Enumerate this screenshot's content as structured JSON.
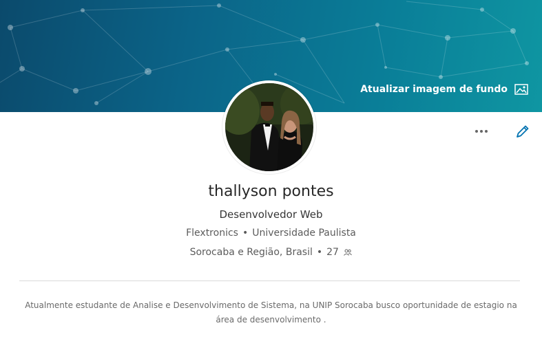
{
  "banner": {
    "update_background_label": "Atualizar imagem de fundo",
    "update_background_icon": "image-icon"
  },
  "profile": {
    "name": "thallyson pontes",
    "headline": "Desenvolvedor Web",
    "company": "Flextronics",
    "school": "Universidade Paulista",
    "location": "Sorocaba e Região, Brasil",
    "connections": "27",
    "connections_icon": "people-icon",
    "summary": "Atualmente estudante de Analise e Desenvolvimento de Sistema, na UNIP Sorocaba busco oportunidade de estagio na área de desenvolvimento ."
  },
  "actions": {
    "more_icon": "more-icon",
    "edit_icon": "pencil-icon"
  },
  "colors": {
    "banner_dark": "#0b4a6c",
    "banner_light": "#0f96a2",
    "accent": "#0073b1"
  }
}
